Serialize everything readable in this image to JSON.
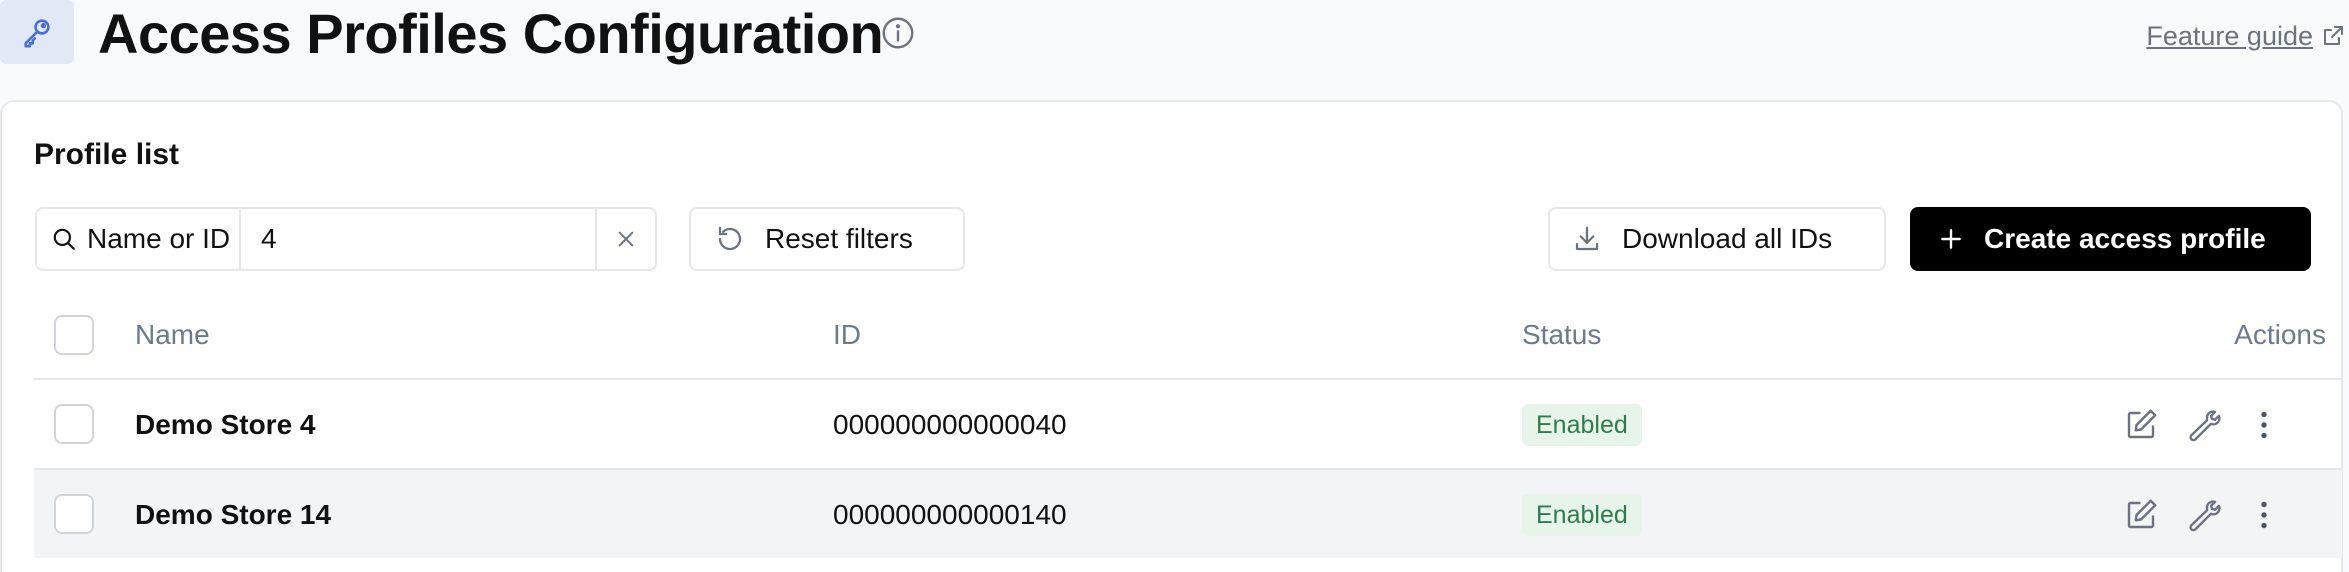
{
  "header": {
    "title": "Access Profiles Configuration",
    "feature_guide_label": "Feature guide"
  },
  "panel": {
    "title": "Profile list",
    "search": {
      "label": "Name or ID",
      "value": "4"
    },
    "buttons": {
      "reset": "Reset filters",
      "download": "Download all IDs",
      "create": "Create access profile"
    }
  },
  "table": {
    "columns": {
      "name": "Name",
      "id": "ID",
      "status": "Status",
      "actions": "Actions"
    },
    "rows": [
      {
        "name": "Demo Store 4",
        "id": "000000000000040",
        "status": "Enabled"
      },
      {
        "name": "Demo Store 14",
        "id": "000000000000140",
        "status": "Enabled"
      }
    ]
  },
  "colors": {
    "accent_bg": "#e3e8f6",
    "primary_button": "#000000",
    "status_enabled_bg": "#e6f4ea",
    "status_enabled_text": "#2f7d4b",
    "header_text": "#6b7a8f"
  },
  "icons": [
    "key-icon",
    "info-icon",
    "external-link-icon",
    "search-icon",
    "clear-icon",
    "reset-icon",
    "download-icon",
    "plus-icon",
    "edit-icon",
    "wrench-icon",
    "more-vertical-icon"
  ]
}
